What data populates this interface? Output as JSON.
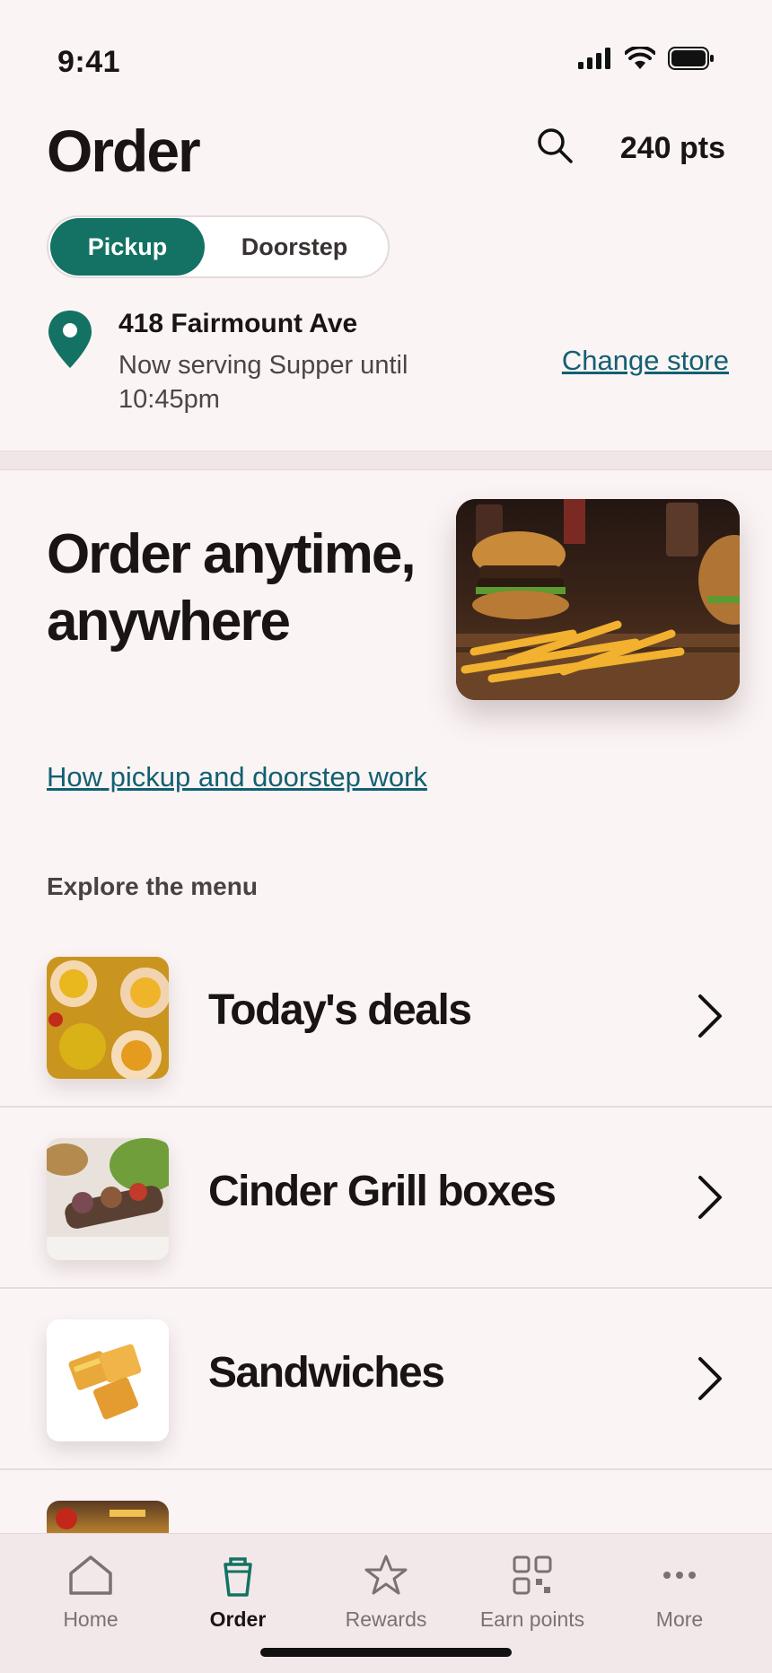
{
  "status": {
    "time": "9:41"
  },
  "header": {
    "title": "Order",
    "points": "240 pts"
  },
  "mode_toggle": {
    "options": [
      "Pickup",
      "Doorstep"
    ],
    "selected": "Pickup"
  },
  "store": {
    "name": "418 Fairmount Ave",
    "status": "Now serving Supper until 10:45pm",
    "change_label": "Change store"
  },
  "hero": {
    "title": "Order anytime, anywhere",
    "link": "How pickup and doorstep work"
  },
  "menu": {
    "heading": "Explore the menu",
    "items": [
      {
        "label": "Today's deals"
      },
      {
        "label": "Cinder Grill boxes"
      },
      {
        "label": "Sandwiches"
      }
    ]
  },
  "tabbar": {
    "items": [
      {
        "label": "Home",
        "icon": "home-icon"
      },
      {
        "label": "Order",
        "icon": "bag-icon"
      },
      {
        "label": "Rewards",
        "icon": "star-icon"
      },
      {
        "label": "Earn points",
        "icon": "qr-icon"
      },
      {
        "label": "More",
        "icon": "more-icon"
      }
    ],
    "active": "Order"
  },
  "colors": {
    "accent": "#137263",
    "link": "#126071",
    "background": "#fbf4f5"
  }
}
